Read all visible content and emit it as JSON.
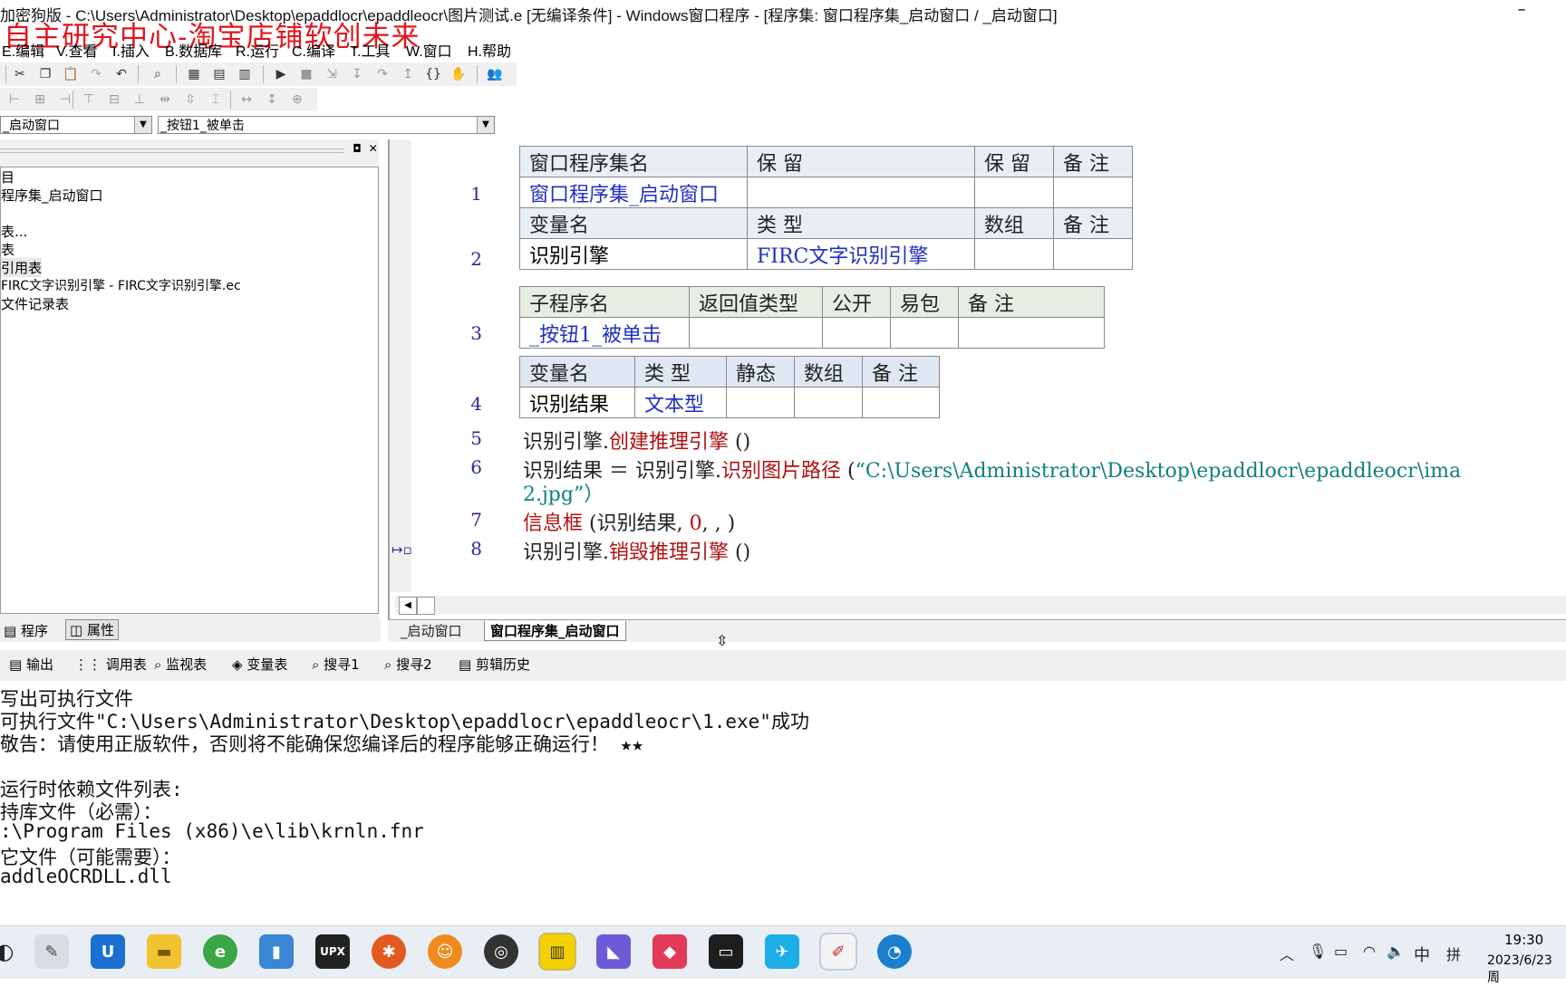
{
  "window": {
    "title": "加密狗版 - C:\\Users\\Administrator\\Desktop\\epaddlocr\\epaddleocr\\图片测试.e [无编译条件] - Windows窗口程序 - [程序集: 窗口程序集_启动窗口 / _启动窗口]",
    "minimize_glyph": "–",
    "watermark": "自主研究中心-淘宝店铺软创未来"
  },
  "menu": [
    "E.编辑",
    "V.查看",
    "I.插入",
    "B.数据库",
    "R.运行",
    "C.编译",
    "T.工具",
    "W.窗口",
    "H.帮助"
  ],
  "combos": {
    "left": "_启动窗口",
    "right": "_按钮1_被单击"
  },
  "tree": [
    "目",
    "程序集_启动窗口",
    "",
    "表...",
    "表",
    "引用表",
    "FIRC文字识别引擎 - FIRC文字识别引擎.ec",
    "文件记录表"
  ],
  "left_tabs": [
    "程序",
    "属性"
  ],
  "table1": {
    "headers": [
      "窗口程序集名",
      "保 留",
      "保 留",
      "备 注"
    ],
    "row": [
      "窗口程序集_启动窗口",
      "",
      "",
      ""
    ],
    "var_headers": [
      "变量名",
      "类 型",
      "数组",
      "备 注"
    ],
    "var_row": [
      "识别引擎",
      "FIRC文字识别引擎",
      "",
      ""
    ]
  },
  "table2": {
    "headers": [
      "子程序名",
      "返回值类型",
      "公开",
      "易包",
      "备 注"
    ],
    "row": [
      "_按钮1_被单击",
      "",
      "",
      "",
      ""
    ]
  },
  "table3": {
    "headers": [
      "变量名",
      "类 型",
      "静态",
      "数组",
      "备 注"
    ],
    "row": [
      "识别结果",
      "文本型",
      "",
      "",
      ""
    ]
  },
  "line_numbers": [
    "1",
    "2",
    "3",
    "4",
    "5",
    "6",
    "7",
    "8"
  ],
  "code": {
    "l5a": "识别引擎.",
    "l5b": "创建推理引擎",
    "l5c": " ()",
    "l6a": "识别结果 ＝ 识别引擎.",
    "l6b": "识别图片路径",
    "l6c": " (",
    "l6d": "“C:\\Users\\Administrator\\Desktop\\epaddlocr\\epaddleocr\\ima",
    "l6e": "2.jpg”）",
    "l7a": "信息框",
    "l7b": " (识别结果, ",
    "l7c": "0",
    "l7d": ", , )",
    "l8a": "识别引擎.",
    "l8b": "销毁推理引擎",
    "l8c": " ()"
  },
  "editor_tabs": [
    "_启动窗口",
    "窗口程序集_启动窗口"
  ],
  "output_tabs": [
    "输出",
    "调用表",
    "监视表",
    "变量表",
    "搜寻1",
    "搜寻2",
    "剪辑历史"
  ],
  "output_lines": [
    "写出可执行文件",
    "可执行文件\"C:\\Users\\Administrator\\Desktop\\epaddlocr\\epaddleocr\\1.exe\"成功",
    "敬告：请使用正版软件，否则将不能确保您编译后的程序能够正确运行！ ★★",
    "",
    "运行时依赖文件列表:",
    "持库文件（必需）：",
    ":\\Program Files (x86)\\e\\lib\\krnln.fnr",
    "它文件（可能需要）：",
    "addleOCRDLL.dll"
  ],
  "taskbar": {
    "icons": [
      "start",
      "notepad",
      "outlook",
      "explorer",
      "ie",
      "files",
      "upx",
      "tool-red",
      "orange-app",
      "obs",
      "yellow-app",
      "vs",
      "red-app",
      "terminal",
      "bird-app",
      "e-app",
      "edge"
    ],
    "tray": {
      "ime": "中",
      "layout": "拼",
      "time": "19:30",
      "date": "2023/6/23 周"
    }
  }
}
